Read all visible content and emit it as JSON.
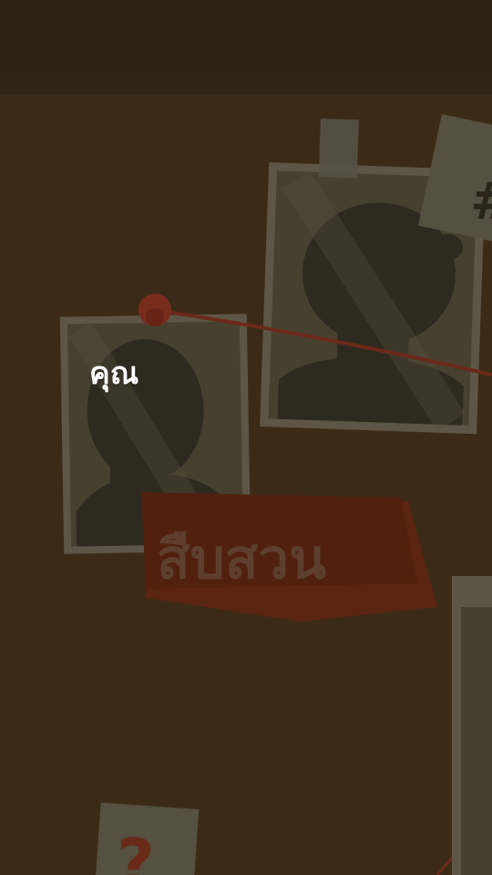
{
  "scene": {
    "dialogue": "คุณ",
    "banner_label": "สืบสวน",
    "hash_note": "#",
    "question_note": "?"
  },
  "colors": {
    "board": "#3b2b16",
    "top_bar": "#2e2214",
    "photo_frame": "#6b6251",
    "photo_inner": "#4f4839",
    "banner": "#5a2512",
    "string": "#6a2a18",
    "pin": "#7a2c1c",
    "text": "#ffffff"
  },
  "icons": {
    "silhouette_left": "person-silhouette-icon",
    "silhouette_right": "person-silhouette-icon",
    "pin": "push-pin-icon"
  }
}
